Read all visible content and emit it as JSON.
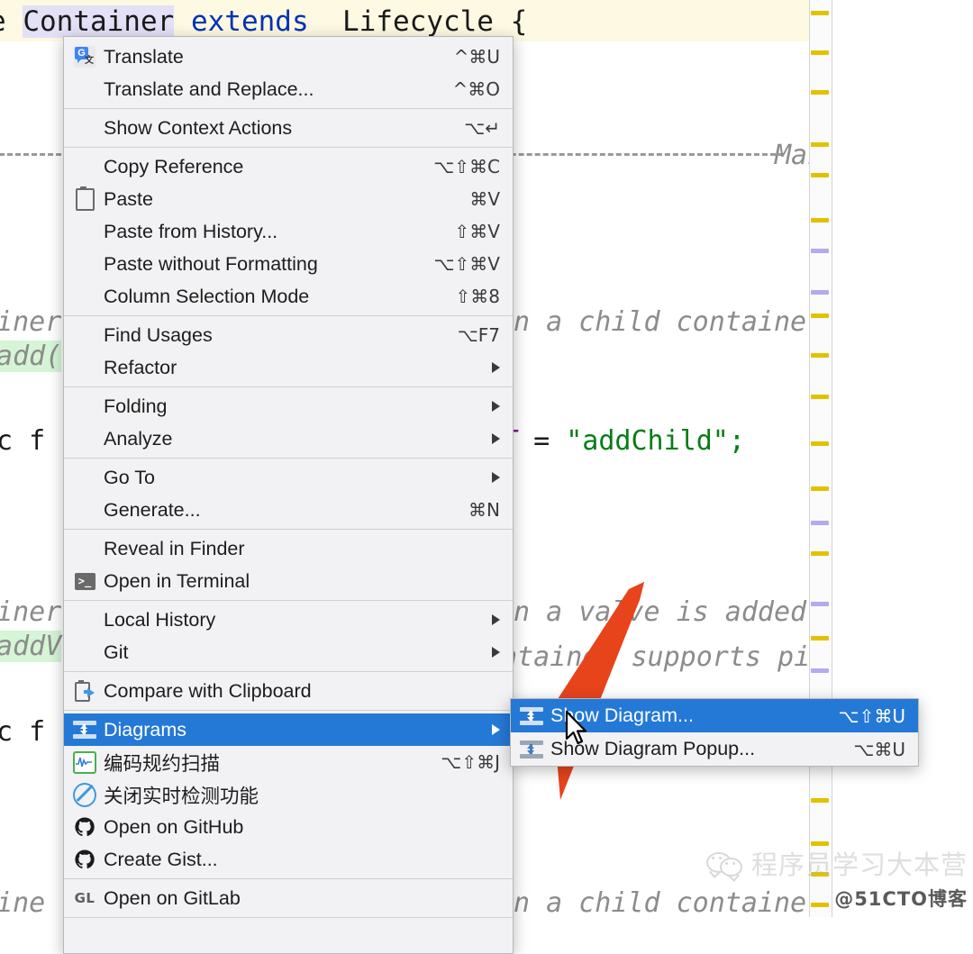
{
  "editor": {
    "lines": [
      {
        "id": "l1",
        "text": "e Container extends Lifecycle {"
      },
      {
        "id": "l2",
        "text": "Man"
      },
      {
        "id": "l3",
        "text": "ainer"
      },
      {
        "id": "l4",
        "text": ">add("
      },
      {
        "id": "l5",
        "text": "ic f"
      },
      {
        "id": "l6",
        "text": "n a child container"
      },
      {
        "id": "l7",
        "text": "T = \"addChild\";"
      },
      {
        "id": "l8",
        "text": "n a valve is added"
      },
      {
        "id": "l9",
        "text": "ntainer supports pi"
      },
      {
        "id": "l10",
        "text": "ainer"
      },
      {
        "id": "l11",
        "text": ">addV"
      },
      {
        "id": "l12",
        "text": "ic f"
      },
      {
        "id": "l13",
        "text": "aine"
      },
      {
        "id": "l14",
        "text": "n a child container"
      }
    ],
    "tokens": {
      "kw_e": "e ",
      "selected_word": "Container",
      "kw_extends": " extends ",
      "type_lifecycle": " Lifecycle {",
      "field_t": "T",
      "equals": " = ",
      "string_addchild": "\"addChild\";"
    }
  },
  "context_menu": {
    "groups": [
      {
        "items": [
          {
            "icon": "translate-icon",
            "label": "Translate",
            "shortcut": "^⌘U",
            "submenu": false
          },
          {
            "icon": "none",
            "label": "Translate and Replace...",
            "shortcut": "^⌘O",
            "submenu": false
          }
        ]
      },
      {
        "items": [
          {
            "icon": "lightbulb-icon",
            "label": "Show Context Actions",
            "shortcut": "⌥↵",
            "submenu": false
          }
        ]
      },
      {
        "items": [
          {
            "icon": "none",
            "label": "Copy Reference",
            "shortcut": "⌥⇧⌘C",
            "submenu": false
          },
          {
            "icon": "clipboard-icon",
            "label": "Paste",
            "shortcut": "⌘V",
            "submenu": false
          },
          {
            "icon": "none",
            "label": "Paste from History...",
            "shortcut": "⇧⌘V",
            "submenu": false
          },
          {
            "icon": "none",
            "label": "Paste without Formatting",
            "shortcut": "⌥⇧⌘V",
            "submenu": false
          },
          {
            "icon": "none",
            "label": "Column Selection Mode",
            "shortcut": "⇧⌘8",
            "submenu": false
          }
        ]
      },
      {
        "items": [
          {
            "icon": "none",
            "label": "Find Usages",
            "shortcut": "⌥F7",
            "submenu": false
          },
          {
            "icon": "none",
            "label": "Refactor",
            "shortcut": "",
            "submenu": true
          }
        ]
      },
      {
        "items": [
          {
            "icon": "none",
            "label": "Folding",
            "shortcut": "",
            "submenu": true
          },
          {
            "icon": "none",
            "label": "Analyze",
            "shortcut": "",
            "submenu": true
          }
        ]
      },
      {
        "items": [
          {
            "icon": "none",
            "label": "Go To",
            "shortcut": "",
            "submenu": true
          },
          {
            "icon": "none",
            "label": "Generate...",
            "shortcut": "⌘N",
            "submenu": false
          }
        ]
      },
      {
        "items": [
          {
            "icon": "none",
            "label": "Reveal in Finder",
            "shortcut": "",
            "submenu": false
          },
          {
            "icon": "terminal-icon",
            "label": "Open in Terminal",
            "shortcut": "",
            "submenu": false
          }
        ]
      },
      {
        "items": [
          {
            "icon": "none",
            "label": "Local History",
            "shortcut": "",
            "submenu": true
          },
          {
            "icon": "none",
            "label": "Git",
            "shortcut": "",
            "submenu": true
          }
        ]
      },
      {
        "items": [
          {
            "icon": "compare-clipboard-icon",
            "label": "Compare with Clipboard",
            "shortcut": "",
            "submenu": false
          }
        ]
      },
      {
        "items": [
          {
            "icon": "diagram-icon",
            "label": "Diagrams",
            "shortcut": "",
            "submenu": true,
            "selected": true
          },
          {
            "icon": "scan-icon",
            "label": "编码规约扫描",
            "shortcut": "⌥⇧⌘J",
            "submenu": false
          },
          {
            "icon": "ban-icon",
            "label": "关闭实时检测功能",
            "shortcut": "",
            "submenu": false
          },
          {
            "icon": "github-icon",
            "label": "Open on GitHub",
            "shortcut": "",
            "submenu": false
          },
          {
            "icon": "github-icon",
            "label": "Create Gist...",
            "shortcut": "",
            "submenu": false
          }
        ]
      },
      {
        "items": [
          {
            "icon": "gitlab-icon",
            "label": "Open on GitLab",
            "shortcut": "",
            "submenu": false
          }
        ]
      }
    ]
  },
  "submenu": {
    "items": [
      {
        "icon": "diagram-icon",
        "label": "Show Diagram...",
        "shortcut": "⌥⇧⌘U",
        "selected": true
      },
      {
        "icon": "diagram-icon",
        "label": "Show Diagram Popup...",
        "shortcut": "⌥⌘U",
        "selected": false
      }
    ]
  },
  "watermark": {
    "account": "程序员学习大本营",
    "site": "@51CTO博客"
  },
  "colors": {
    "menu_bg": "#f2f1f3",
    "selection_blue": "#2579d6",
    "caret_line": "#fdf9e2",
    "keyword": "#0033b3",
    "string": "#067d17",
    "field": "#871094",
    "comment": "#8c8c8c",
    "marker_yellow": "#e3c100",
    "marker_purple": "#b3aaf0",
    "annotation_arrow": "#e8441c"
  }
}
